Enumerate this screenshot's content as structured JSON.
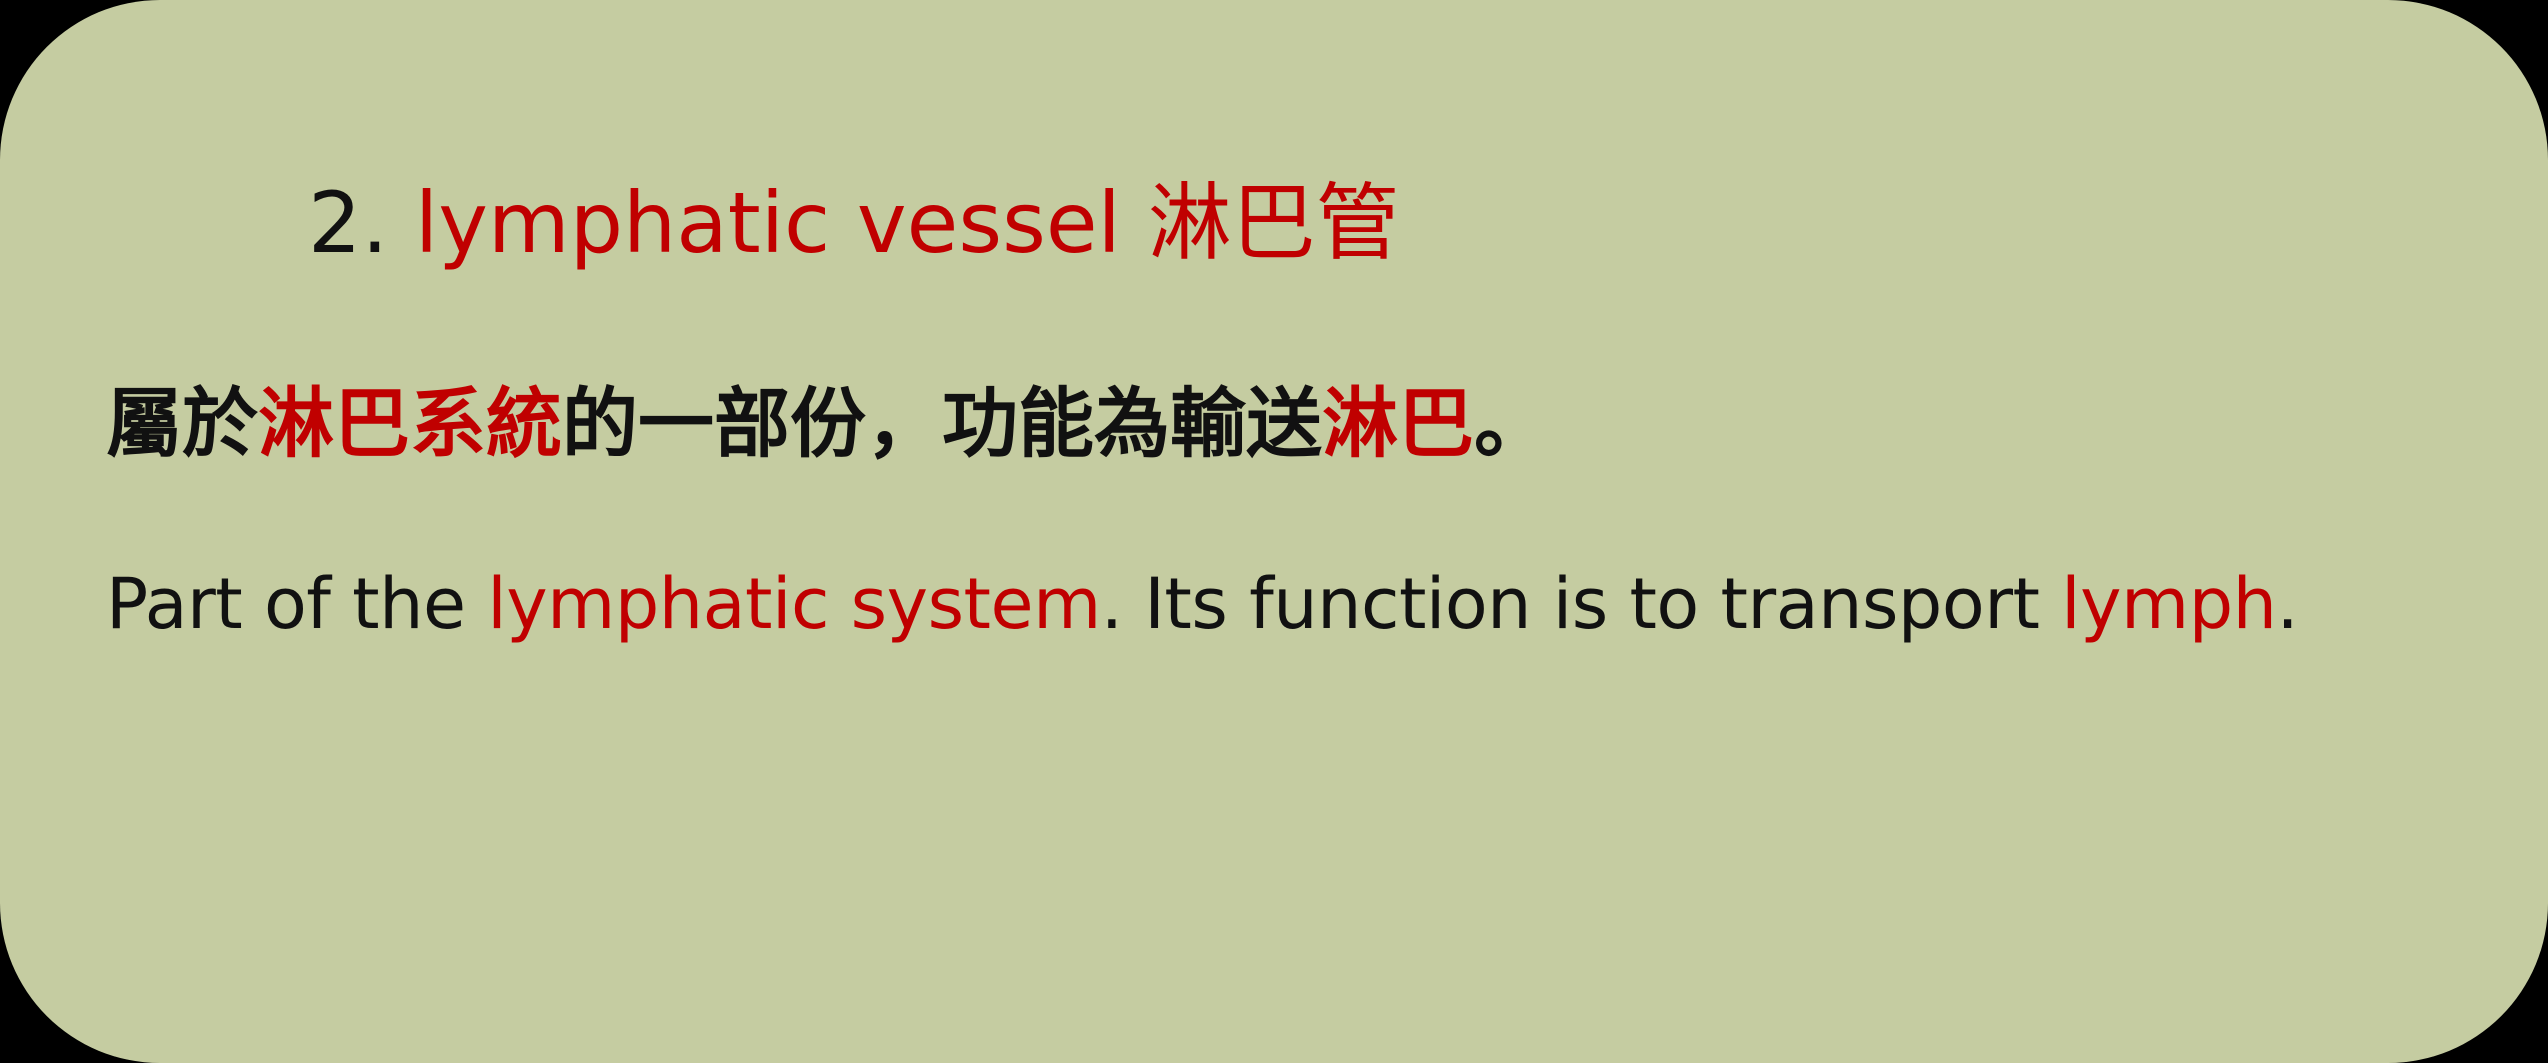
{
  "colors": {
    "background": "#000000",
    "card": "#c5cca1",
    "text": "#111111",
    "highlight": "#c00000"
  },
  "title": {
    "number": "2.",
    "term": "lymphatic vessel 淋巴管"
  },
  "chinese_sentence": {
    "seg1": "屬於",
    "seg2_hl": "淋巴系統",
    "seg3": "的一部份，功能為輸送",
    "seg4_hl": "淋巴",
    "seg5": "。"
  },
  "english_sentence": {
    "seg1": "Part of the ",
    "seg2_hl": "lymphatic system",
    "seg3": ". Its function is to transport ",
    "seg4_hl": "lymph",
    "seg5": "."
  }
}
